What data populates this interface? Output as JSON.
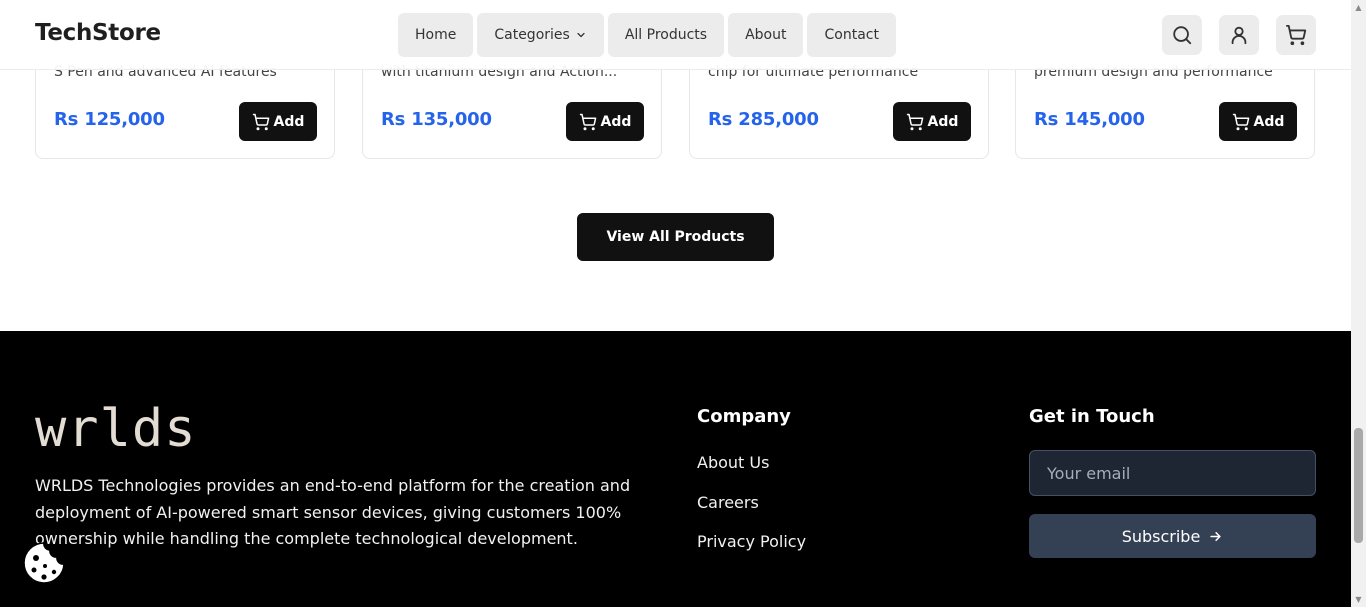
{
  "header": {
    "logo": "TechStore",
    "nav": {
      "home": "Home",
      "categories": "Categories",
      "all_products": "All Products",
      "about": "About",
      "contact": "Contact"
    }
  },
  "products": [
    {
      "desc": "S Pen and advanced AI features",
      "price": "Rs 125,000",
      "add_label": "Add"
    },
    {
      "desc": "with titanium design and Action...",
      "price": "Rs 135,000",
      "add_label": "Add"
    },
    {
      "desc": "chip for ultimate performance",
      "price": "Rs 285,000",
      "add_label": "Add"
    },
    {
      "desc": "premium design and performance",
      "price": "Rs 145,000",
      "add_label": "Add"
    }
  ],
  "view_all_label": "View All Products",
  "footer": {
    "brand": "wrlds",
    "about": "WRLDS Technologies provides an end-to-end platform for the creation and deployment of AI-powered smart sensor devices, giving customers 100% ownership while handling the complete technological development.",
    "company_title": "Company",
    "links": [
      "About Us",
      "Careers",
      "Privacy Policy"
    ],
    "contact_title": "Get in Touch",
    "email_placeholder": "Your email",
    "subscribe_label": "Subscribe"
  },
  "colors": {
    "price": "#2563eb",
    "button": "#111111",
    "footer_bg": "#000000",
    "subscribe_bg": "#344054",
    "input_bg": "#1e2533"
  },
  "icons": [
    "search-icon",
    "user-icon",
    "cart-icon",
    "chevron-down-icon",
    "arrow-right-icon",
    "cookie-icon"
  ]
}
